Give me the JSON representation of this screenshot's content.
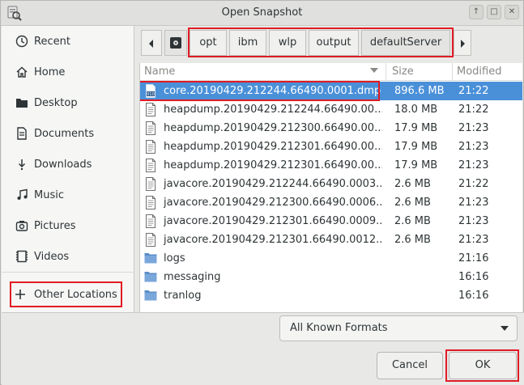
{
  "window": {
    "title": "Open Snapshot",
    "controls": [
      "up",
      "maximize",
      "close"
    ]
  },
  "sidebar": {
    "items": [
      {
        "label": "Recent",
        "icon": "clock-icon"
      },
      {
        "label": "Home",
        "icon": "home-icon"
      },
      {
        "label": "Desktop",
        "icon": "folder-icon"
      },
      {
        "label": "Documents",
        "icon": "document-icon"
      },
      {
        "label": "Downloads",
        "icon": "download-icon"
      },
      {
        "label": "Music",
        "icon": "music-icon"
      },
      {
        "label": "Pictures",
        "icon": "camera-icon"
      },
      {
        "label": "Videos",
        "icon": "video-icon"
      }
    ],
    "other_locations": {
      "label": "Other Locations",
      "icon": "plus-icon"
    }
  },
  "pathbar": {
    "crumbs": [
      "opt",
      "ibm",
      "wlp",
      "output",
      "defaultServer"
    ],
    "root_icon": "disk-icon"
  },
  "filelist": {
    "columns": {
      "name": "Name",
      "size": "Size",
      "modified": "Modified"
    },
    "rows": [
      {
        "name": "core.20190429.212244.66490.0001.dmp",
        "size": "896.6 MB",
        "modified": "21:22",
        "type": "binary",
        "selected": true
      },
      {
        "name": "heapdump.20190429.212244.66490.00...",
        "size": "18.0 MB",
        "modified": "21:22",
        "type": "file"
      },
      {
        "name": "heapdump.20190429.212300.66490.00...",
        "size": "17.9 MB",
        "modified": "21:23",
        "type": "file"
      },
      {
        "name": "heapdump.20190429.212301.66490.00...",
        "size": "17.9 MB",
        "modified": "21:23",
        "type": "file"
      },
      {
        "name": "heapdump.20190429.212301.66490.00...",
        "size": "17.9 MB",
        "modified": "21:23",
        "type": "file"
      },
      {
        "name": "javacore.20190429.212244.66490.0003....",
        "size": "2.6 MB",
        "modified": "21:22",
        "type": "file"
      },
      {
        "name": "javacore.20190429.212300.66490.0006....",
        "size": "2.6 MB",
        "modified": "21:23",
        "type": "file"
      },
      {
        "name": "javacore.20190429.212301.66490.0009....",
        "size": "2.6 MB",
        "modified": "21:23",
        "type": "file"
      },
      {
        "name": "javacore.20190429.212301.66490.0012....",
        "size": "2.6 MB",
        "modified": "21:23",
        "type": "file"
      },
      {
        "name": "logs",
        "size": "",
        "modified": "21:16",
        "type": "folder"
      },
      {
        "name": "messaging",
        "size": "",
        "modified": "16:16",
        "type": "folder"
      },
      {
        "name": "tranlog",
        "size": "",
        "modified": "16:16",
        "type": "folder"
      }
    ]
  },
  "filter": {
    "selected": "All Known Formats"
  },
  "buttons": {
    "cancel": "Cancel",
    "ok": "OK"
  },
  "colors": {
    "selection": "#4a90d9",
    "highlight": "#e01b24"
  }
}
